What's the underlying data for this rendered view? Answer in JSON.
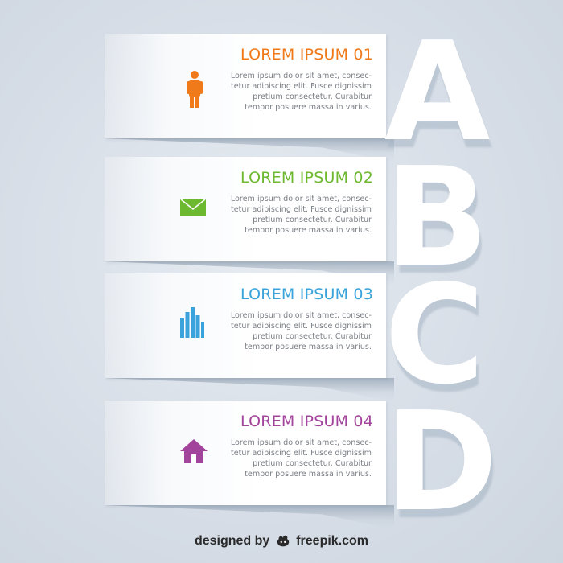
{
  "items": [
    {
      "title": "LOREM IPSUM 01",
      "color": "#f07a1a",
      "icon": "person-icon",
      "letter": "A",
      "lines": [
        "Lorem ipsum dolor sit amet, consec-",
        "tetur adipiscing elit. Fusce dignissim",
        "pretium consectetur. Curabitur",
        "tempor posuere massa in varius."
      ]
    },
    {
      "title": "LOREM IPSUM 02",
      "color": "#6cb82e",
      "icon": "envelope-icon",
      "letter": "B",
      "lines": [
        "Lorem ipsum dolor sit amet, consec-",
        "tetur adipiscing elit. Fusce dignissim",
        "pretium consectetur. Curabitur",
        "tempor posuere massa in varius."
      ]
    },
    {
      "title": "LOREM IPSUM 03",
      "color": "#3aa3db",
      "icon": "bar-chart-icon",
      "letter": "C",
      "lines": [
        "Lorem ipsum dolor sit amet, consec-",
        "tetur adipiscing elit. Fusce dignissim",
        "pretium consectetur. Curabitur",
        "tempor posuere massa in varius."
      ]
    },
    {
      "title": "LOREM IPSUM 04",
      "color": "#a3449c",
      "icon": "house-icon",
      "letter": "D",
      "lines": [
        "Lorem ipsum dolor sit amet, consec-",
        "tetur adipiscing elit. Fusce dignissim",
        "pretium consectetur. Curabitur",
        "tempor posuere massa in varius."
      ]
    }
  ],
  "footer": {
    "designed": "designed by",
    "brand": "freepik.com",
    "logo_icon": "freepik-logo-icon"
  }
}
